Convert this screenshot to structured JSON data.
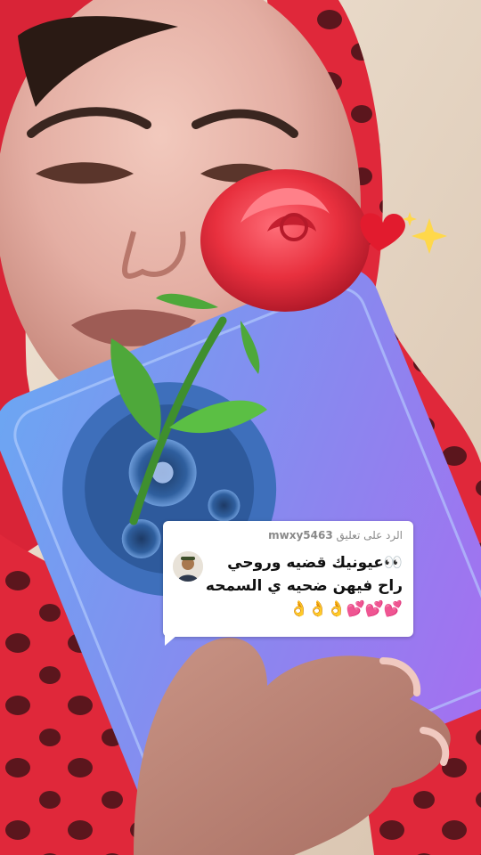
{
  "reply_card": {
    "prefix": "الرد على تعليق",
    "username": "mwxy5463",
    "lines": [
      "👀عيونيك قضيه وروحي",
      "راح فيهن ضحيه ي السمحه",
      "💕💕💕👌👌👌"
    ]
  },
  "colors": {
    "scarf_red": "#e0283a",
    "phone_blue": "#5a8fe0",
    "phone_purple": "#9a6be8",
    "rose_red": "#e8303e",
    "leaf_green": "#4ea83a",
    "card_bg": "#ffffff"
  },
  "stickers": [
    "rose-sticker",
    "heart-sticker",
    "sparkle-sticker"
  ]
}
